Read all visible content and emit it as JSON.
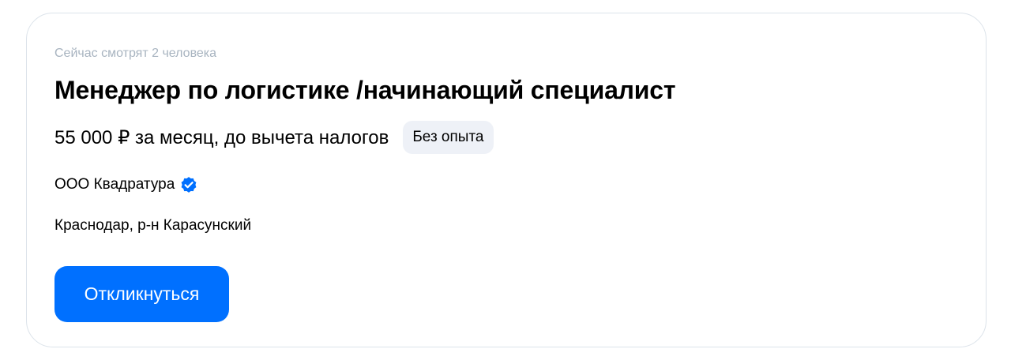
{
  "vacancy": {
    "viewers_text": "Сейчас смотрят 2 человека",
    "title": "Менеджер по логистике /начинающий специалист",
    "salary": "55 000 ₽ за месяц, до вычета налогов",
    "experience_badge": "Без опыта",
    "company": "ООО Квадратура",
    "company_verified_icon": "verified-badge-icon",
    "location": "Краснодар, р-н Карасунский",
    "apply_label": "Откликнуться"
  },
  "colors": {
    "accent": "#0070ff",
    "badge_bg": "#eef1f7",
    "muted_text": "#a8b4c0",
    "card_border": "#dce3ea"
  }
}
